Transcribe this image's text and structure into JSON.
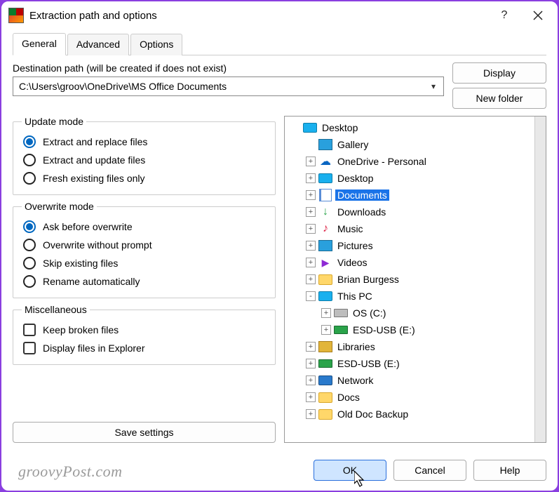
{
  "title": "Extraction path and options",
  "tabs": {
    "general": "General",
    "advanced": "Advanced",
    "options": "Options",
    "active": "general"
  },
  "dest": {
    "label": "Destination path (will be created if does not exist)",
    "value": "C:\\Users\\groov\\OneDrive\\MS Office Documents"
  },
  "buttons": {
    "display": "Display",
    "new_folder": "New folder",
    "save_settings": "Save settings",
    "ok": "OK",
    "cancel": "Cancel",
    "help": "Help"
  },
  "groups": {
    "update": {
      "legend": "Update mode",
      "items": {
        "replace": "Extract and replace files",
        "update": "Extract and update files",
        "fresh": "Fresh existing files only"
      },
      "selected": "replace"
    },
    "overwrite": {
      "legend": "Overwrite mode",
      "items": {
        "ask": "Ask before overwrite",
        "noprompt": "Overwrite without prompt",
        "skip": "Skip existing files",
        "rename": "Rename automatically"
      },
      "selected": "ask"
    },
    "misc": {
      "legend": "Miscellaneous",
      "items": {
        "keep_broken": "Keep broken files",
        "show_explorer": "Display files in Explorer"
      }
    }
  },
  "tree": [
    {
      "depth": 0,
      "expander": "",
      "icon": "monitor",
      "label": "Desktop",
      "key": "desktop-root"
    },
    {
      "depth": 1,
      "expander": "",
      "icon": "pic",
      "label": "Gallery",
      "key": "gallery"
    },
    {
      "depth": 1,
      "expander": "+",
      "icon": "onedrive",
      "label": "OneDrive - Personal",
      "key": "onedrive"
    },
    {
      "depth": 1,
      "expander": "+",
      "icon": "monitor",
      "label": "Desktop",
      "key": "desktop"
    },
    {
      "depth": 1,
      "expander": "+",
      "icon": "doc",
      "label": "Documents",
      "key": "documents",
      "selected": true
    },
    {
      "depth": 1,
      "expander": "+",
      "icon": "down",
      "label": "Downloads",
      "key": "downloads"
    },
    {
      "depth": 1,
      "expander": "+",
      "icon": "music",
      "label": "Music",
      "key": "music"
    },
    {
      "depth": 1,
      "expander": "+",
      "icon": "pic",
      "label": "Pictures",
      "key": "pictures"
    },
    {
      "depth": 1,
      "expander": "+",
      "icon": "video",
      "label": "Videos",
      "key": "videos"
    },
    {
      "depth": 1,
      "expander": "+",
      "icon": "folder",
      "label": "Brian Burgess",
      "key": "brian"
    },
    {
      "depth": 1,
      "expander": "-",
      "icon": "thispc",
      "label": "This PC",
      "key": "thispc"
    },
    {
      "depth": 2,
      "expander": "+",
      "icon": "drive",
      "label": "OS (C:)",
      "key": "os-c"
    },
    {
      "depth": 2,
      "expander": "+",
      "icon": "usb",
      "label": "ESD-USB (E:)",
      "key": "esd-usb-1"
    },
    {
      "depth": 1,
      "expander": "+",
      "icon": "library",
      "label": "Libraries",
      "key": "libraries"
    },
    {
      "depth": 1,
      "expander": "+",
      "icon": "usb",
      "label": "ESD-USB (E:)",
      "key": "esd-usb-2"
    },
    {
      "depth": 1,
      "expander": "+",
      "icon": "network",
      "label": "Network",
      "key": "network"
    },
    {
      "depth": 1,
      "expander": "+",
      "icon": "folder",
      "label": "Docs",
      "key": "docs"
    },
    {
      "depth": 1,
      "expander": "+",
      "icon": "folder",
      "label": "Old Doc Backup",
      "key": "old-doc-backup"
    }
  ],
  "watermark": "groovyPost.com"
}
